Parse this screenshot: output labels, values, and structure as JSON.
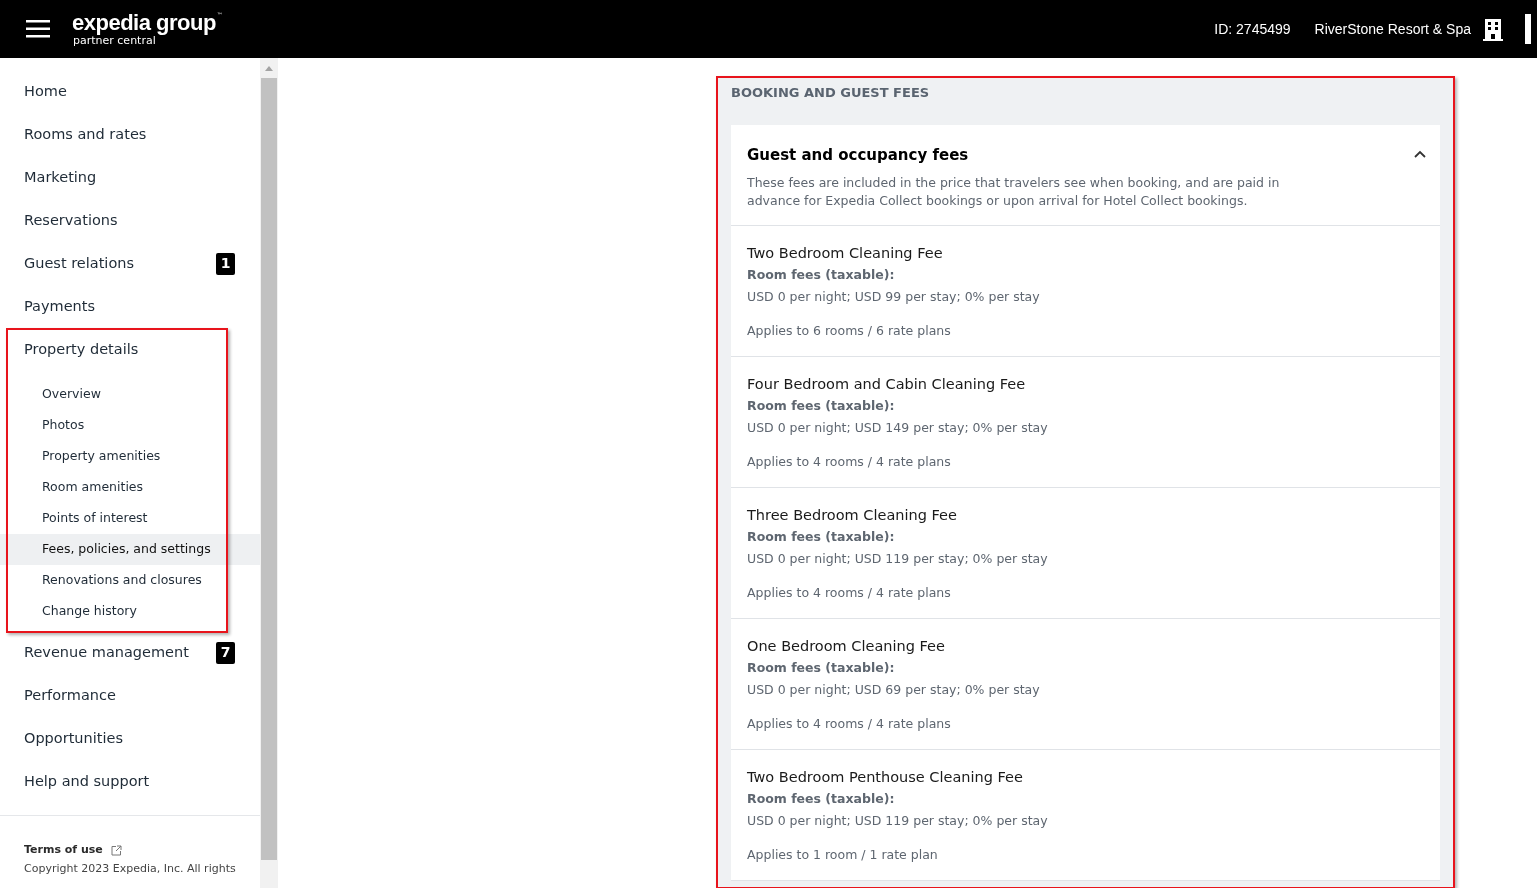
{
  "header": {
    "brand": "expedia group",
    "trademark": "™",
    "subbrand": "partner central",
    "property_id": "ID: 2745499",
    "property_name": "RiverStone Resort & Spa"
  },
  "sidebar": {
    "items": [
      {
        "label": "Home",
        "selected": false
      },
      {
        "label": "Rooms and rates",
        "selected": false
      },
      {
        "label": "Marketing",
        "selected": false
      },
      {
        "label": "Reservations",
        "selected": false
      },
      {
        "label": "Guest relations",
        "badge": "1",
        "selected": false
      },
      {
        "label": "Payments",
        "selected": false
      },
      {
        "label": "Property details",
        "selected": false,
        "highlighted": true,
        "children": [
          {
            "label": "Overview",
            "selected": false
          },
          {
            "label": "Photos",
            "selected": false
          },
          {
            "label": "Property amenities",
            "selected": false
          },
          {
            "label": "Room amenities",
            "selected": false
          },
          {
            "label": "Points of interest",
            "selected": false
          },
          {
            "label": "Fees, policies, and settings",
            "selected": true
          },
          {
            "label": "Renovations and closures",
            "selected": false
          },
          {
            "label": "Change history",
            "selected": false
          }
        ]
      },
      {
        "label": "Revenue management",
        "badge": "7",
        "selected": false
      },
      {
        "label": "Performance",
        "selected": false
      },
      {
        "label": "Opportunities",
        "selected": false
      },
      {
        "label": "Help and support",
        "selected": false
      }
    ],
    "footer": {
      "terms": "Terms of use",
      "copyright": "Copyright 2023 Expedia, Inc. All rights"
    }
  },
  "section": {
    "title": "BOOKING AND GUEST FEES",
    "highlighted": true,
    "card": {
      "title": "Guest and occupancy fees",
      "expanded": true,
      "description": "These fees are included in the price that travelers see when booking, and are paid in advance for Expedia Collect bookings or upon arrival for Hotel Collect bookings.",
      "fees": [
        {
          "name": "Two Bedroom Cleaning Fee",
          "category": "Room fees (taxable):",
          "detail": "USD 0 per night; USD 99 per stay; 0% per stay",
          "applies": "Applies to 6 rooms / 6 rate plans"
        },
        {
          "name": "Four Bedroom and Cabin Cleaning Fee",
          "category": "Room fees (taxable):",
          "detail": "USD 0 per night; USD 149 per stay; 0% per stay",
          "applies": "Applies to 4 rooms / 4 rate plans"
        },
        {
          "name": "Three Bedroom Cleaning Fee",
          "category": "Room fees (taxable):",
          "detail": "USD 0 per night; USD 119 per stay; 0% per stay",
          "applies": "Applies to 4 rooms / 4 rate plans"
        },
        {
          "name": "One Bedroom Cleaning Fee",
          "category": "Room fees (taxable):",
          "detail": "USD 0 per night; USD 69 per stay; 0% per stay",
          "applies": "Applies to 4 rooms / 4 rate plans"
        },
        {
          "name": "Two Bedroom Penthouse Cleaning Fee",
          "category": "Room fees (taxable):",
          "detail": "USD 0 per night; USD 119 per stay; 0% per stay",
          "applies": "Applies to 1 room / 1 rate plan"
        }
      ]
    }
  }
}
